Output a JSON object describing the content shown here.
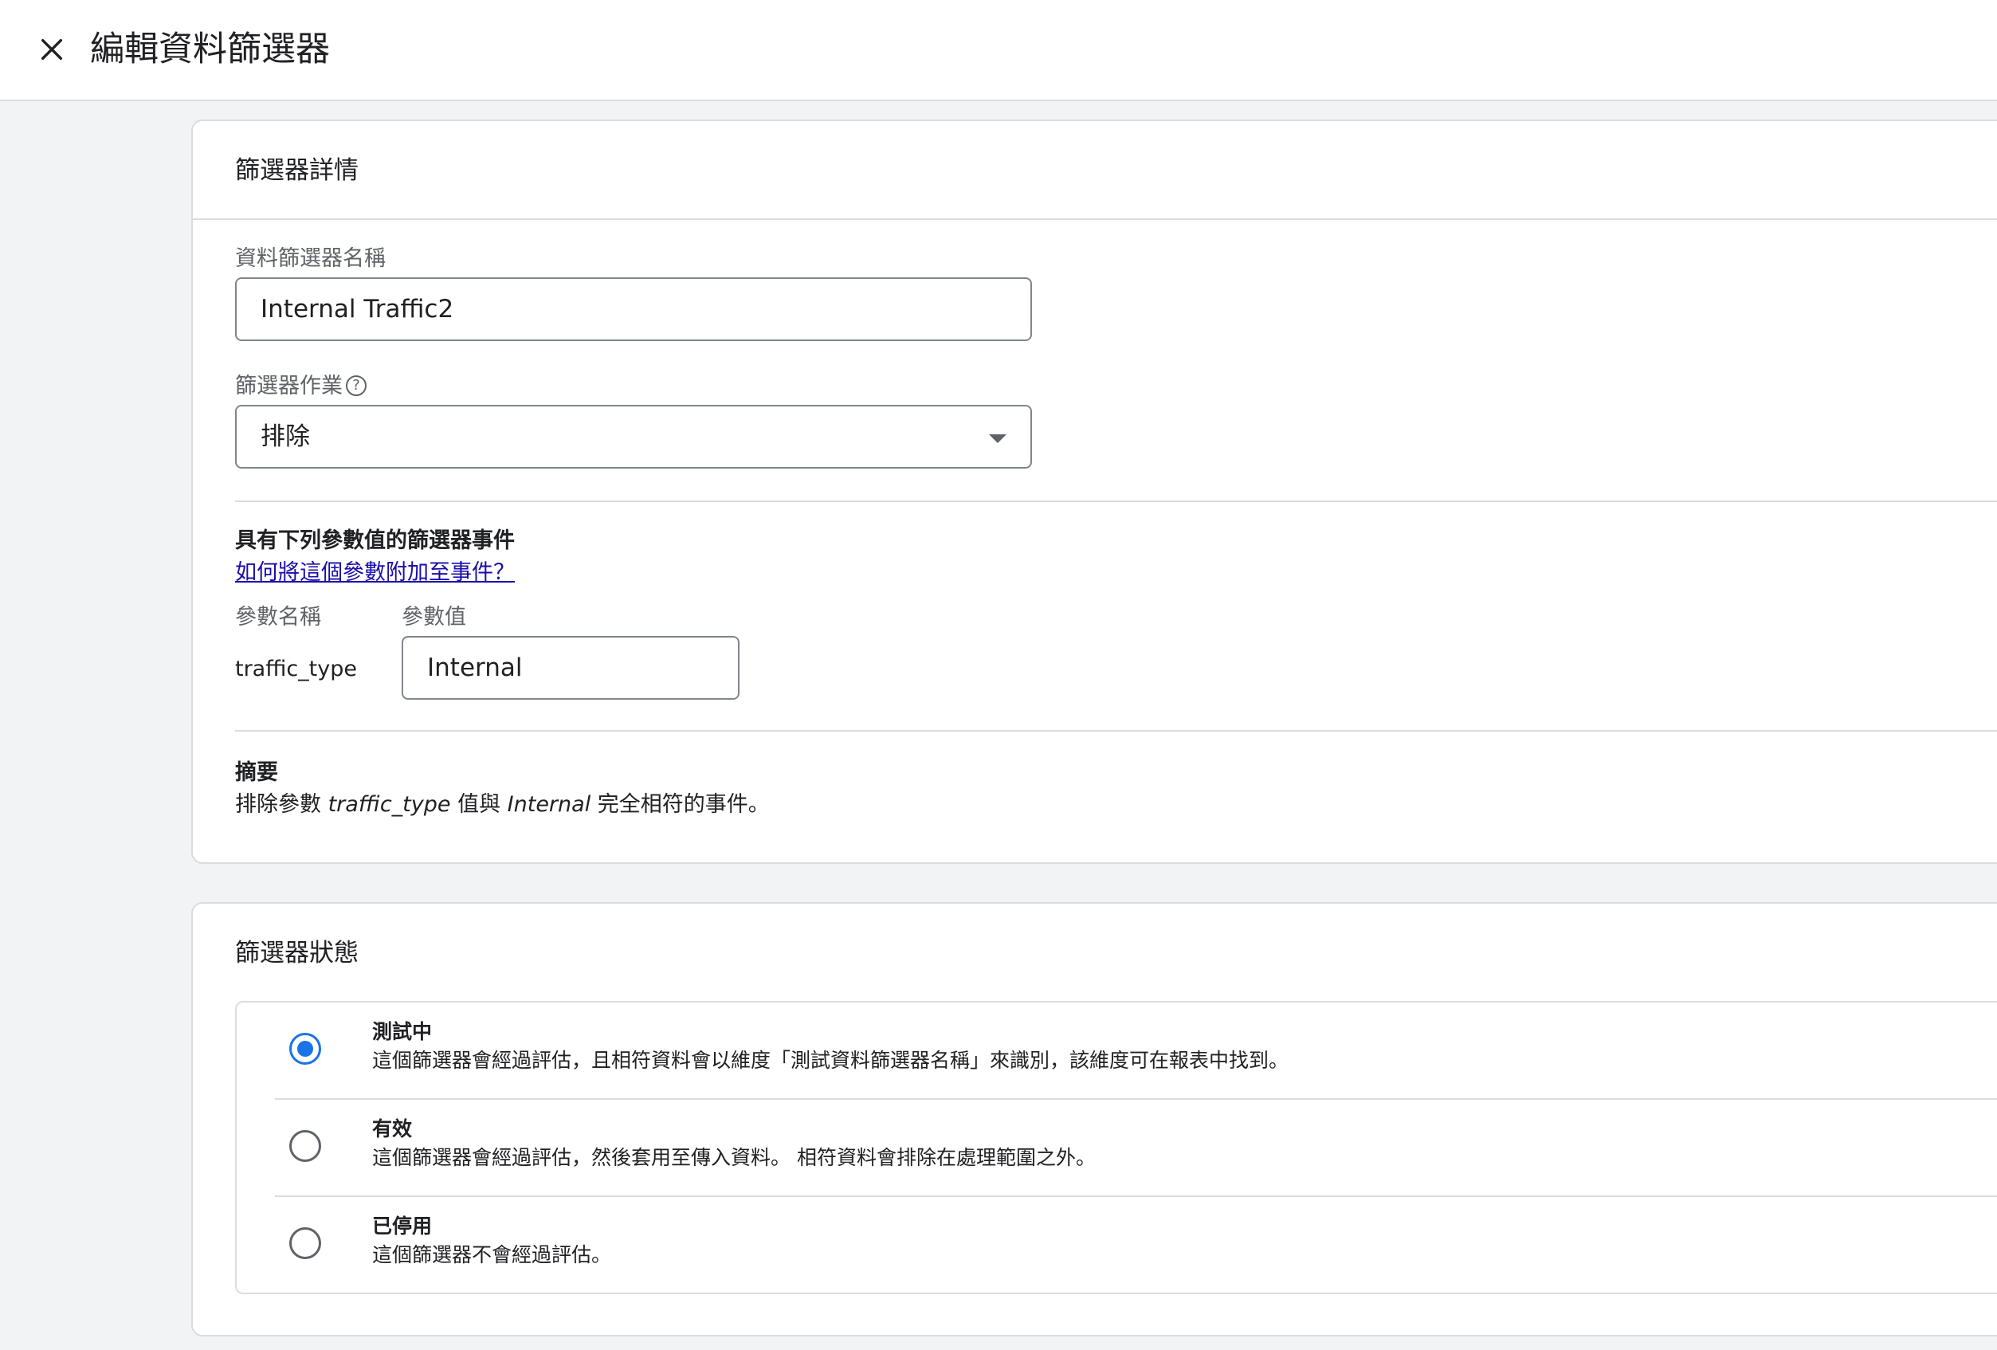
{
  "header": {
    "title": "編輯資料篩選器"
  },
  "details": {
    "title": "篩選器詳情",
    "name_label": "資料篩選器名稱",
    "name_value": "Internal Traffic2",
    "operation_label": "篩選器作業",
    "operation_value": "排除",
    "events_heading": "具有下列參數值的篩選器事件",
    "help_link": "如何將這個參數附加至事件？",
    "param_name_label": "參數名稱",
    "param_value_label": "參數值",
    "param_name": "traffic_type",
    "param_value": "Internal",
    "summary_heading": "摘要",
    "summary_prefix": "排除參數 ",
    "summary_param": "traffic_type",
    "summary_mid": " 值與 ",
    "summary_value": "Internal",
    "summary_suffix": " 完全相符的事件。"
  },
  "status": {
    "title": "篩選器狀態",
    "options": [
      {
        "title": "測試中",
        "desc": "這個篩選器會經過評估，且相符資料會以維度「測試資料篩選器名稱」來識別，該維度可在報表中找到。",
        "checked": true
      },
      {
        "title": "有效",
        "desc": "這個篩選器會經過評估，然後套用至傳入資料。 相符資料會排除在處理範圍之外。",
        "checked": false
      },
      {
        "title": "已停用",
        "desc": "這個篩選器不會經過評估。",
        "checked": false
      }
    ]
  },
  "colors": {
    "accent": "#1a73e8",
    "link": "#1a0dab"
  }
}
